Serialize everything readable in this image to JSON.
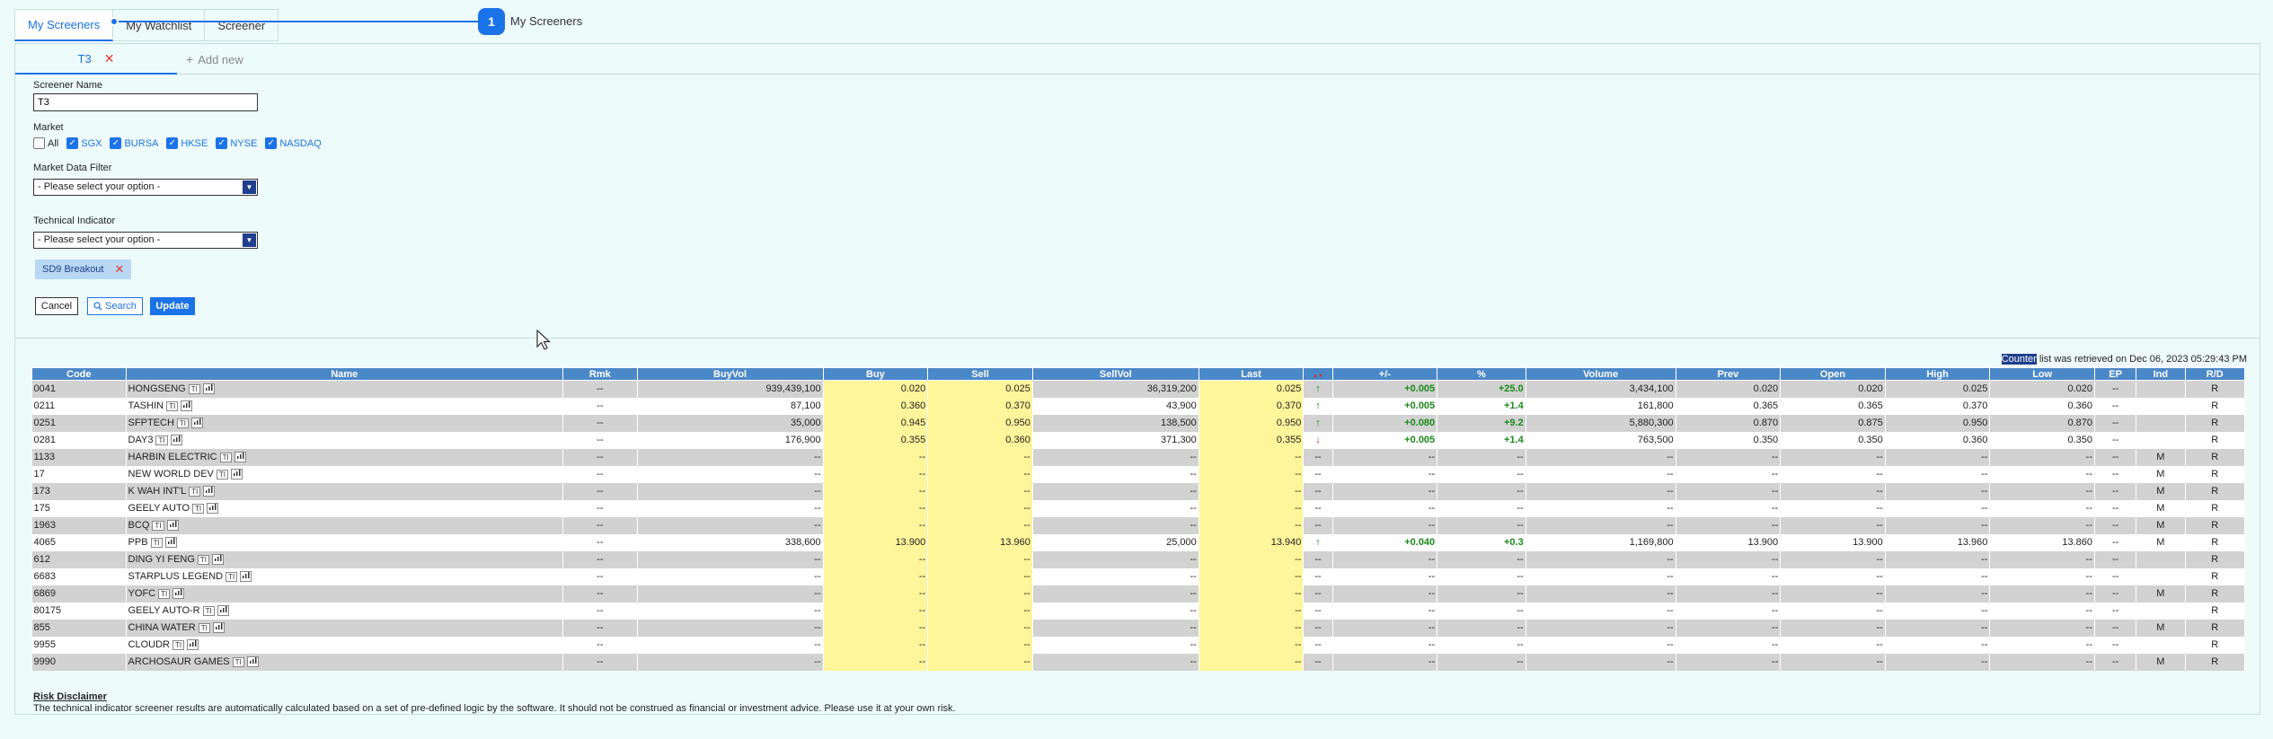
{
  "top_tabs": [
    "My Screeners",
    "My Watchlist",
    "Screener"
  ],
  "tour": {
    "step": "1",
    "label": "My Screeners"
  },
  "sub_tabs": {
    "active": "T3",
    "close": "✕",
    "add_plus": "+",
    "add": "Add new"
  },
  "form": {
    "screener_name_label": "Screener Name",
    "screener_name_value": "T3",
    "market_label": "Market",
    "markets": [
      {
        "label": "All",
        "checked": false
      },
      {
        "label": "SGX",
        "checked": true
      },
      {
        "label": "BURSA",
        "checked": true
      },
      {
        "label": "HKSE",
        "checked": true
      },
      {
        "label": "NYSE",
        "checked": true
      },
      {
        "label": "NASDAQ",
        "checked": true
      }
    ],
    "market_data_filter_label": "Market Data Filter",
    "market_data_filter_value": "- Please select your option -",
    "technical_indicator_label": "Technical Indicator",
    "technical_indicator_value": "- Please select your option -",
    "chip": "SD9 Breakout",
    "chip_close": "✕",
    "cancel": "Cancel",
    "search": "Search",
    "update": "Update"
  },
  "retrieved": {
    "highlight": "Counter",
    "text": " list was retrieved on Dec 06, 2023 05:29:43 PM"
  },
  "table": {
    "headers": [
      "Code",
      "Name",
      "Rmk",
      "BuyVol",
      "Buy",
      "Sell",
      "SellVol",
      "Last",
      "",
      "+/-",
      "%",
      "Volume",
      "Prev",
      "Open",
      "High",
      "Low",
      "EP",
      "Ind",
      "R/D"
    ],
    "rows": [
      [
        "0041",
        "HONGSENG",
        "--",
        "939,439,100",
        "0.020",
        "0.025",
        "36,319,200",
        "0.025",
        "up",
        "+0.005",
        "+25.0",
        "3,434,100",
        "0.020",
        "0.020",
        "0.025",
        "0.020",
        "--",
        "",
        "R"
      ],
      [
        "0211",
        "TASHIN",
        "--",
        "87,100",
        "0.360",
        "0.370",
        "43,900",
        "0.370",
        "up",
        "+0.005",
        "+1.4",
        "161,800",
        "0.365",
        "0.365",
        "0.370",
        "0.360",
        "--",
        "",
        "R"
      ],
      [
        "0251",
        "SFPTECH",
        "--",
        "35,000",
        "0.945",
        "0.950",
        "138,500",
        "0.950",
        "up",
        "+0.080",
        "+9.2",
        "5,880,300",
        "0.870",
        "0.875",
        "0.950",
        "0.870",
        "--",
        "",
        "R"
      ],
      [
        "0281",
        "DAY3",
        "--",
        "176,900",
        "0.355",
        "0.360",
        "371,300",
        "0.355",
        "down",
        "+0.005",
        "+1.4",
        "763,500",
        "0.350",
        "0.350",
        "0.360",
        "0.350",
        "--",
        "",
        "R"
      ],
      [
        "1133",
        "HARBIN ELECTRIC",
        "--",
        "--",
        "--",
        "--",
        "--",
        "--",
        "--",
        "--",
        "--",
        "--",
        "--",
        "--",
        "--",
        "--",
        "--",
        "M",
        "R"
      ],
      [
        "17",
        "NEW WORLD DEV",
        "--",
        "--",
        "--",
        "--",
        "--",
        "--",
        "--",
        "--",
        "--",
        "--",
        "--",
        "--",
        "--",
        "--",
        "--",
        "M",
        "R"
      ],
      [
        "173",
        "K WAH INT'L",
        "--",
        "--",
        "--",
        "--",
        "--",
        "--",
        "--",
        "--",
        "--",
        "--",
        "--",
        "--",
        "--",
        "--",
        "--",
        "M",
        "R"
      ],
      [
        "175",
        "GEELY AUTO",
        "--",
        "--",
        "--",
        "--",
        "--",
        "--",
        "--",
        "--",
        "--",
        "--",
        "--",
        "--",
        "--",
        "--",
        "--",
        "M",
        "R"
      ],
      [
        "1963",
        "BCQ",
        "--",
        "--",
        "--",
        "--",
        "--",
        "--",
        "--",
        "--",
        "--",
        "--",
        "--",
        "--",
        "--",
        "--",
        "--",
        "M",
        "R"
      ],
      [
        "4065",
        "PPB",
        "--",
        "338,600",
        "13.900",
        "13.960",
        "25,000",
        "13.940",
        "up",
        "+0.040",
        "+0.3",
        "1,169,800",
        "13.900",
        "13.900",
        "13.960",
        "13.860",
        "--",
        "M",
        "R"
      ],
      [
        "612",
        "DING YI FENG",
        "--",
        "--",
        "--",
        "--",
        "--",
        "--",
        "--",
        "--",
        "--",
        "--",
        "--",
        "--",
        "--",
        "--",
        "--",
        "",
        "R"
      ],
      [
        "6683",
        "STARPLUS LEGEND",
        "--",
        "--",
        "--",
        "--",
        "--",
        "--",
        "--",
        "--",
        "--",
        "--",
        "--",
        "--",
        "--",
        "--",
        "--",
        "",
        "R"
      ],
      [
        "6869",
        "YOFC",
        "--",
        "--",
        "--",
        "--",
        "--",
        "--",
        "--",
        "--",
        "--",
        "--",
        "--",
        "--",
        "--",
        "--",
        "--",
        "M",
        "R"
      ],
      [
        "80175",
        "GEELY AUTO-R",
        "--",
        "--",
        "--",
        "--",
        "--",
        "--",
        "--",
        "--",
        "--",
        "--",
        "--",
        "--",
        "--",
        "--",
        "--",
        "",
        "R"
      ],
      [
        "855",
        "CHINA WATER",
        "--",
        "--",
        "--",
        "--",
        "--",
        "--",
        "--",
        "--",
        "--",
        "--",
        "--",
        "--",
        "--",
        "--",
        "--",
        "M",
        "R"
      ],
      [
        "9955",
        "CLOUDR",
        "--",
        "--",
        "--",
        "--",
        "--",
        "--",
        "--",
        "--",
        "--",
        "--",
        "--",
        "--",
        "--",
        "--",
        "--",
        "",
        "R"
      ],
      [
        "9990",
        "ARCHOSAUR GAMES",
        "--",
        "--",
        "--",
        "--",
        "--",
        "--",
        "--",
        "--",
        "--",
        "--",
        "--",
        "--",
        "--",
        "--",
        "--",
        "M",
        "R"
      ]
    ]
  },
  "row_icons": {
    "ti": "TI",
    "chart": "chart-icon"
  },
  "arrows": {
    "up": "↑",
    "down": "↓",
    "header": "▲▼"
  },
  "disclaimer": {
    "title": "Risk Disclaimer",
    "text": "The technical indicator screener results are automatically calculated based on a set of pre-defined logic by the software. It should not be construed as financial or investment advice. Please use it at your own risk."
  },
  "colors": {
    "accent": "#1a73e8",
    "header_bg": "#4b88c8",
    "highlight_col": "#fff59a",
    "positive": "#1a8a1a",
    "negative": "#d32f2f"
  }
}
